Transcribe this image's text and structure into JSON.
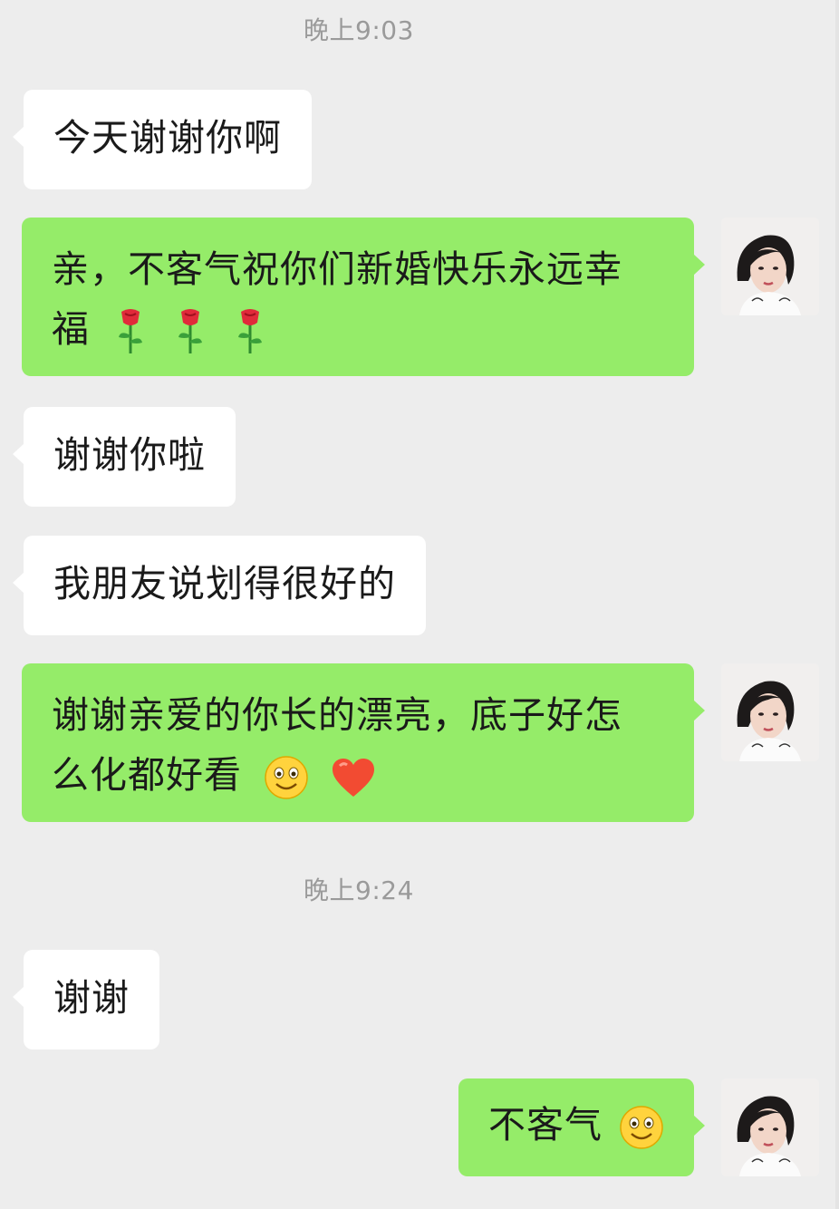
{
  "timestamps": [
    "晚上9:03",
    "晚上9:24"
  ],
  "messages": [
    {
      "side": "left",
      "text": "今天谢谢你啊"
    },
    {
      "side": "right",
      "line1": "亲，不客气祝你们新婚快乐永远幸",
      "line2": "福",
      "emoji": [
        "rose-icon",
        "rose-icon",
        "rose-icon"
      ]
    },
    {
      "side": "left",
      "text": "谢谢你啦"
    },
    {
      "side": "left",
      "text": "我朋友说划得很好的"
    },
    {
      "side": "right",
      "line1": "谢谢亲爱的你长的漂亮，底子好怎",
      "line2": "么化都好看",
      "emoji": [
        "smile-icon",
        "heart-icon"
      ]
    },
    {
      "side": "left",
      "text": "谢谢"
    },
    {
      "side": "right",
      "text": "不客气",
      "emoji": [
        "smile-icon"
      ]
    }
  ],
  "colors": {
    "background": "#ededed",
    "sent_bubble": "#95ec69",
    "received_bubble": "#ffffff",
    "timestamp_text": "#9a9a9a"
  }
}
